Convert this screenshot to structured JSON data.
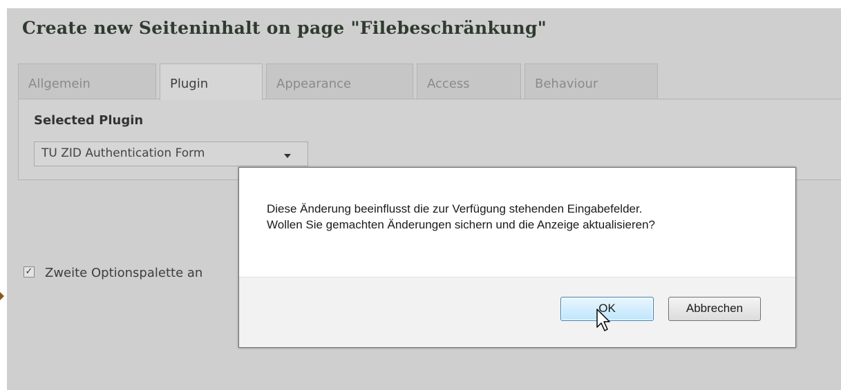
{
  "page": {
    "title": "Create new Seiteninhalt on page \"Filebeschränkung\""
  },
  "tabs": [
    {
      "label": "Allgemein",
      "active": false
    },
    {
      "label": "Plugin",
      "active": true
    },
    {
      "label": "Appearance",
      "active": false
    },
    {
      "label": "Access",
      "active": false
    },
    {
      "label": "Behaviour",
      "active": false
    }
  ],
  "plugin_panel": {
    "label": "Selected Plugin",
    "selected_value": "TU ZID Authentication Form"
  },
  "options": {
    "checkbox_label": "Zweite Optionspalette an",
    "checked": true
  },
  "dialog": {
    "message_line1": "Diese Änderung beeinflusst die zur Verfügung stehenden Eingabefelder.",
    "message_line2": "Wollen Sie gemachten Änderungen sichern und die Anzeige aktualisieren?",
    "ok_label": "OK",
    "cancel_label": "Abbrechen"
  },
  "colors": {
    "overlay_gray": "#cfcfcf",
    "title_text": "#2f3b2f",
    "ok_button_border": "#3c7fb1",
    "marker": "#8a5a14"
  },
  "icons": {
    "dropdown": "chevron-down-icon",
    "checkbox": "checkmark-icon",
    "cursor": "mouse-pointer-icon"
  }
}
